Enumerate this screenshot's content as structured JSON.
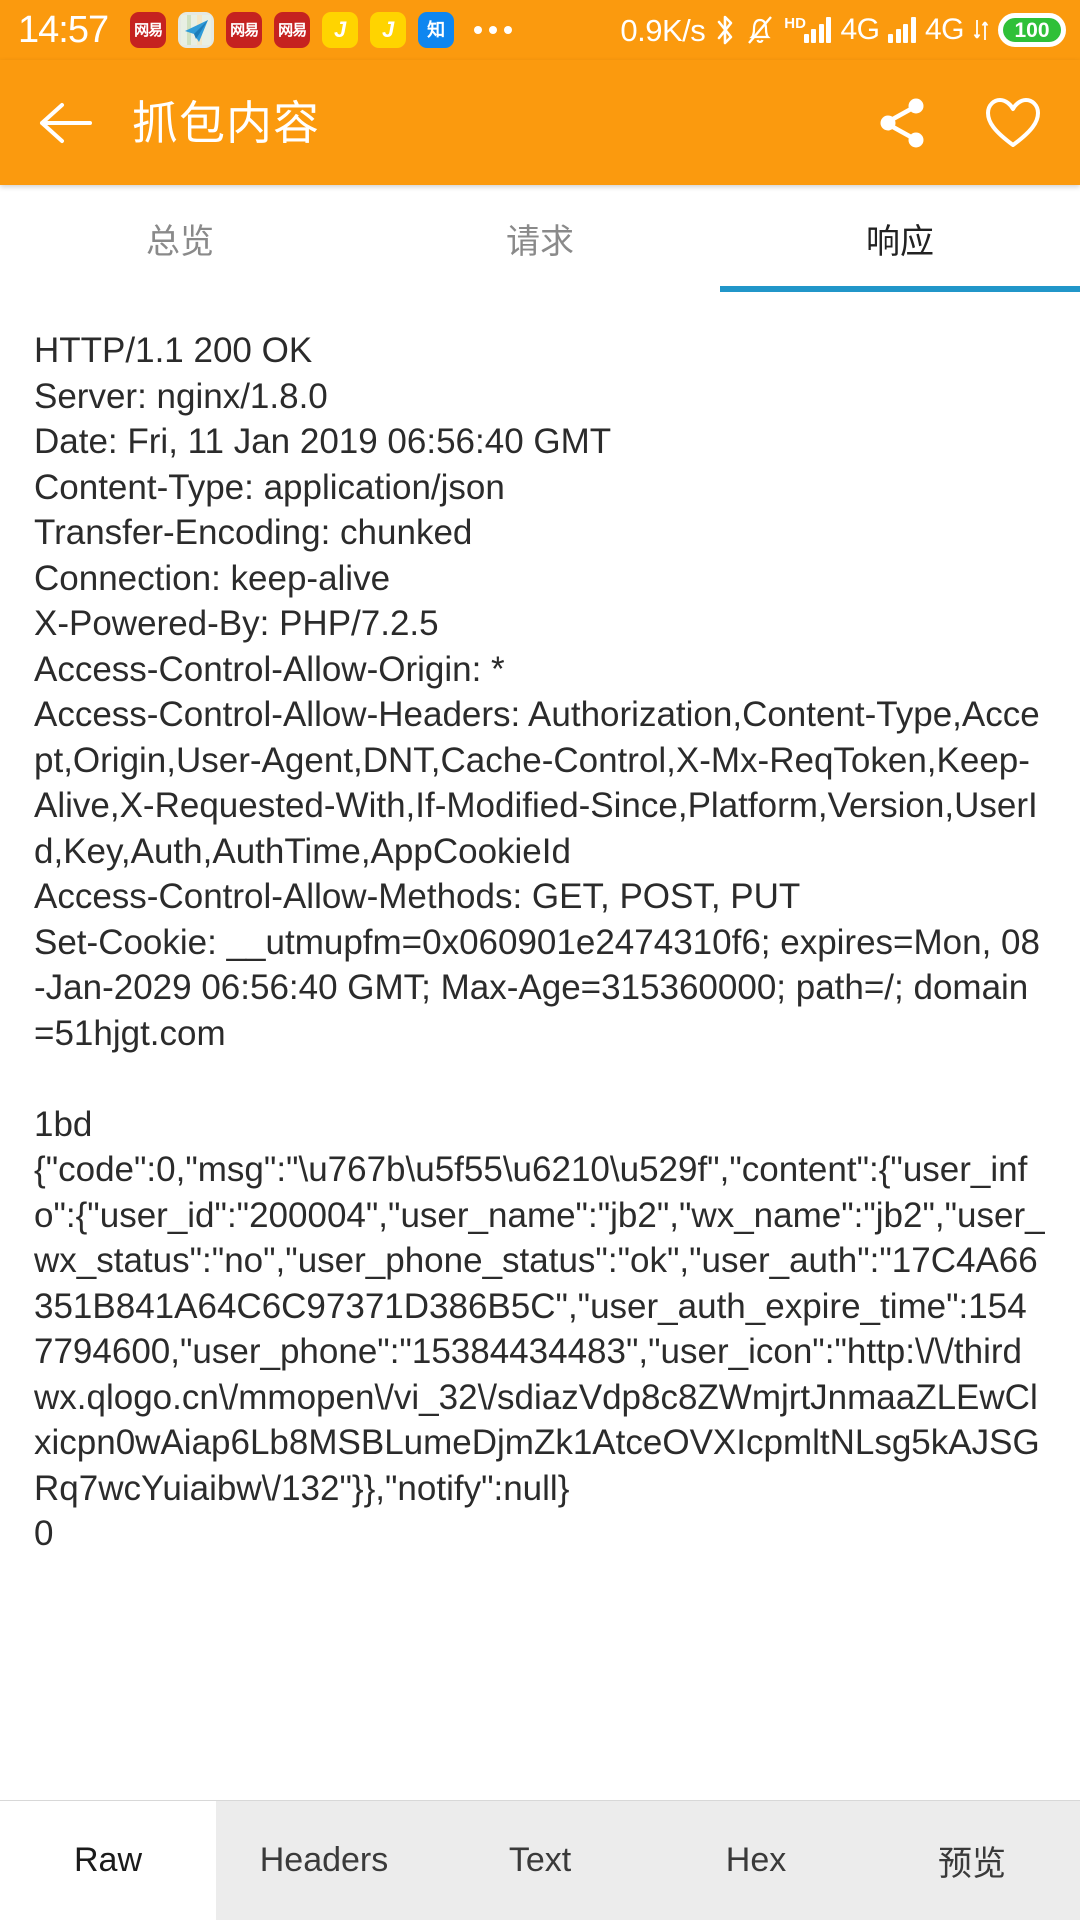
{
  "status_bar": {
    "clock": "14:57",
    "net_speed": "0.9K/s",
    "notification_apps": [
      {
        "name": "netease-news-icon",
        "label": "网易"
      },
      {
        "name": "telegram-icon",
        "label": "✈"
      },
      {
        "name": "netease-news-icon",
        "label": "网易"
      },
      {
        "name": "netease-news-icon",
        "label": "网易"
      },
      {
        "name": "jd-icon",
        "label": "J"
      },
      {
        "name": "jd-icon",
        "label": "J"
      },
      {
        "name": "zhihu-icon",
        "label": "知"
      }
    ],
    "overflow_icon": "more-dots-icon",
    "bluetooth_icon": "bluetooth-icon",
    "silent_icon": "bell-muted-icon",
    "hd_label": "HD",
    "network_1": "4G",
    "network_2": "4G",
    "data_transfer_icon": "data-updown-icon",
    "battery_level": "100",
    "battery_color": "#2FC038"
  },
  "header": {
    "back_icon": "back-arrow-icon",
    "title": "抓包内容",
    "share_icon": "share-icon",
    "favorite_icon": "heart-icon",
    "background_color": "#FB9A0E"
  },
  "tabs": {
    "items": [
      {
        "label": "总览",
        "active": false
      },
      {
        "label": "请求",
        "active": false
      },
      {
        "label": "响应",
        "active": true
      }
    ],
    "active_index": 2,
    "indicator_color": "#2196C9"
  },
  "response": {
    "body": "HTTP/1.1 200 OK\nServer: nginx/1.8.0\nDate: Fri, 11 Jan 2019 06:56:40 GMT\nContent-Type: application/json\nTransfer-Encoding: chunked\nConnection: keep-alive\nX-Powered-By: PHP/7.2.5\nAccess-Control-Allow-Origin: *\nAccess-Control-Allow-Headers: Authorization,Content-Type,Accept,Origin,User-Agent,DNT,Cache-Control,X-Mx-ReqToken,Keep-Alive,X-Requested-With,If-Modified-Since,Platform,Version,UserId,Key,Auth,AuthTime,AppCookieId\nAccess-Control-Allow-Methods: GET, POST, PUT\nSet-Cookie: __utmupfm=0x060901e2474310f6; expires=Mon, 08-Jan-2029 06:56:40 GMT; Max-Age=315360000; path=/; domain=51hjgt.com\n\n1bd\n{\"code\":0,\"msg\":\"\\u767b\\u5f55\\u6210\\u529f\",\"content\":{\"user_info\":{\"user_id\":\"200004\",\"user_name\":\"jb2\",\"wx_name\":\"jb2\",\"user_wx_status\":\"no\",\"user_phone_status\":\"ok\",\"user_auth\":\"17C4A66351B841A64C6C97371D386B5C\",\"user_auth_expire_time\":1547794600,\"user_phone\":\"15384434483\",\"user_icon\":\"http:\\/\\/thirdwx.qlogo.cn\\/mmopen\\/vi_32\\/sdiazVdp8c8ZWmjrtJnmaaZLEwClxicpn0wAiap6Lb8MSBLumeDjmZk1AtceOVXIcpmltNLsg5kAJSGRq7wcYuiaibw\\/132\"}},\"notify\":null}\n0"
  },
  "bottom_bar": {
    "tabs": [
      {
        "label": "Raw",
        "active": true
      },
      {
        "label": "Headers",
        "active": false
      },
      {
        "label": "Text",
        "active": false
      },
      {
        "label": "Hex",
        "active": false
      },
      {
        "label": "预览",
        "active": false
      }
    ]
  }
}
